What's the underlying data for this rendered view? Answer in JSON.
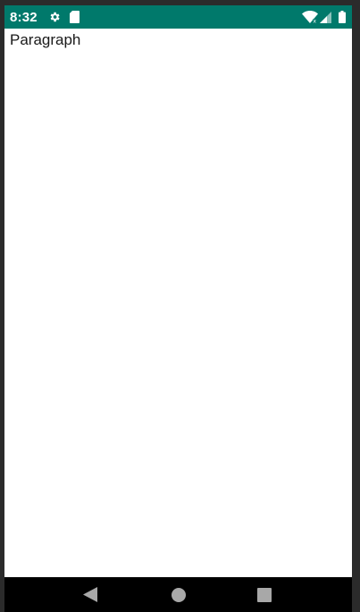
{
  "status_bar": {
    "time": "8:32",
    "icons": [
      "gear-icon",
      "sd-card-icon",
      "wifi-icon",
      "signal-icon",
      "battery-icon"
    ],
    "color": "#00796b"
  },
  "content": {
    "paragraph": "Paragraph"
  },
  "nav_bar": {
    "buttons": [
      "back-icon",
      "home-icon",
      "recents-icon"
    ]
  }
}
